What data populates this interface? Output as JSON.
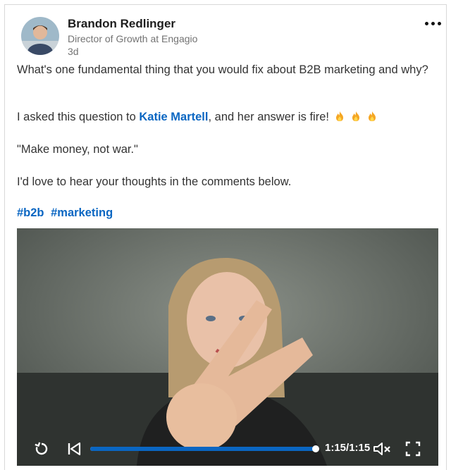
{
  "author": {
    "name": "Brandon Redlinger",
    "headline": "Director of Growth at Engagio",
    "time": "3d"
  },
  "post": {
    "p1": "What's one fundamental thing that you would fix about B2B marketing and why?",
    "p2_before": "I asked this question to ",
    "p2_mention": "Katie Martell",
    "p2_after": ", and her answer is fire!",
    "p3": "\"Make money, not war.\"",
    "p4": "I'd love to hear your thoughts in the comments below.",
    "hashtags": [
      "#b2b",
      "#marketing"
    ],
    "emoji_count": 3
  },
  "video": {
    "time_display": "1:15/1:15",
    "progress": 1.0,
    "muted": true
  },
  "colors": {
    "link": "#0a66c2",
    "progress_track": "#cfd8e2"
  }
}
